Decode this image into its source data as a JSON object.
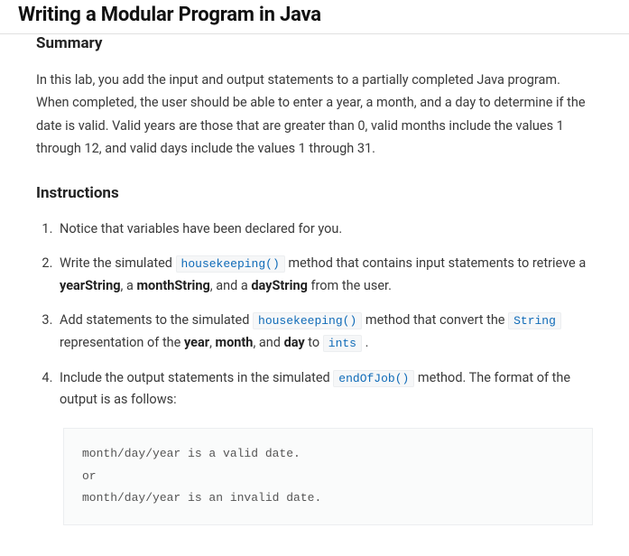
{
  "title": "Writing a Modular Program in Java",
  "sections": {
    "summary": {
      "heading": "Summary",
      "body": "In this lab, you add the input and output statements to a partially completed Java program. When completed, the user should be able to enter a year, a month, and a day to determine if the date is valid. Valid years are those that are greater than 0, valid months include the values 1 through 12, and valid days include the values 1 through 31."
    },
    "instructions": {
      "heading": "Instructions",
      "items": {
        "i1": "Notice that variables have been declared for you.",
        "i2": {
          "p1": "Write the simulated ",
          "code1": "housekeeping()",
          "p2": " method that contains input statements to retrieve a ",
          "b1": "yearString",
          "p3": ", a ",
          "b2": "monthString",
          "p4": ", and a ",
          "b3": "dayString",
          "p5": " from the user."
        },
        "i3": {
          "p1": "Add statements to the simulated ",
          "code1": "housekeeping()",
          "p2": " method that convert the ",
          "code2": "String",
          "p3": " representation of the ",
          "b1": "year",
          "p4": ", ",
          "b2": "month",
          "p5": ", and ",
          "b3": "day",
          "p6": " to ",
          "code3": "ints",
          "p7": " ."
        },
        "i4": {
          "p1": "Include the output statements in the simulated ",
          "code1": "endOfJob()",
          "p2": " method. The format of the output is as follows:"
        }
      },
      "code_block": "month/day/year is a valid date.\nor\nmonth/day/year is an invalid date."
    }
  }
}
